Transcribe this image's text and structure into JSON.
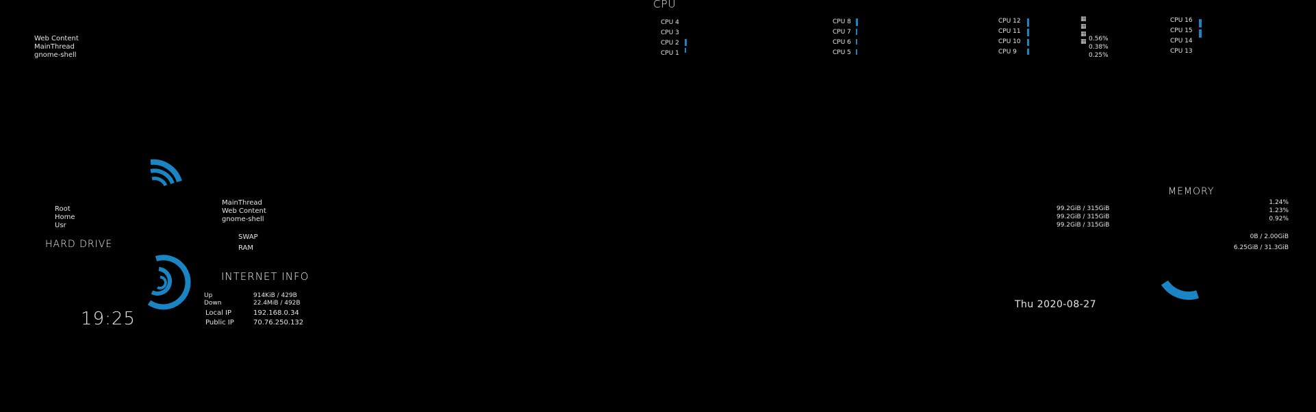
{
  "colors": {
    "accent": "#1a85c5",
    "background": "#000000",
    "text": "#e6e6e6"
  },
  "top_processes": [
    "Web Content",
    "MainThread",
    "gnome-shell"
  ],
  "cpu": {
    "title": "CPU",
    "groups": [
      {
        "cores": [
          {
            "label": "CPU 4",
            "load": 0.0
          },
          {
            "label": "CPU 3",
            "load": 0.0
          },
          {
            "label": "CPU 2",
            "load": 0.5
          },
          {
            "label": "CPU 1",
            "load": 0.2
          }
        ]
      },
      {
        "cores": [
          {
            "label": "CPU 8",
            "load": 0.7
          },
          {
            "label": "CPU 7",
            "load": 0.4
          },
          {
            "label": "CPU 6",
            "load": 0.3
          },
          {
            "label": "CPU 5",
            "load": 0.3
          }
        ]
      },
      {
        "cores": [
          {
            "label": "CPU 12",
            "load": 0.7
          },
          {
            "label": "CPU 11",
            "load": 0.6
          },
          {
            "label": "CPU 10",
            "load": 0.6
          },
          {
            "label": "CPU 9",
            "load": 0.5
          }
        ]
      },
      {
        "cores": [
          {
            "label": "CPU 16",
            "load": 0.8
          },
          {
            "label": "CPU 15",
            "load": 0.8
          },
          {
            "label": "CPU 14",
            "load": 0.0
          },
          {
            "label": "CPU 13",
            "load": 0.0
          }
        ]
      }
    ],
    "process_percents": [
      "0.56%",
      "0.38%",
      "0.25%"
    ]
  },
  "hard_drive": {
    "title": "HARD DRIVE",
    "mounts": [
      "Root",
      "Home",
      "Usr"
    ],
    "usage": [
      "99.2GiB / 315GiB",
      "99.2GiB / 315GiB",
      "99.2GiB / 315GiB"
    ]
  },
  "memory": {
    "title": "MEMORY",
    "processes": [
      "MainThread",
      "Web Content",
      "gnome-shell"
    ],
    "process_percents": [
      "1.24%",
      "1.23%",
      "0.92%"
    ],
    "swap_label": "SWAP",
    "ram_label": "RAM",
    "swap_value": "0B   / 2.00GiB",
    "ram_value": "6.25GiB / 31.3GiB"
  },
  "internet": {
    "title": "INTERNET INFO",
    "up_label": "Up",
    "down_label": "Down",
    "up_value": "914KiB / 429B",
    "down_value": "22.4MiB / 492B",
    "local_ip_label": "Local IP",
    "local_ip": "192.168.0.34",
    "public_ip_label": "Public IP",
    "public_ip": "70.76.250.132"
  },
  "clock": {
    "time": "19:25",
    "date": "Thu 2020-08-27"
  }
}
